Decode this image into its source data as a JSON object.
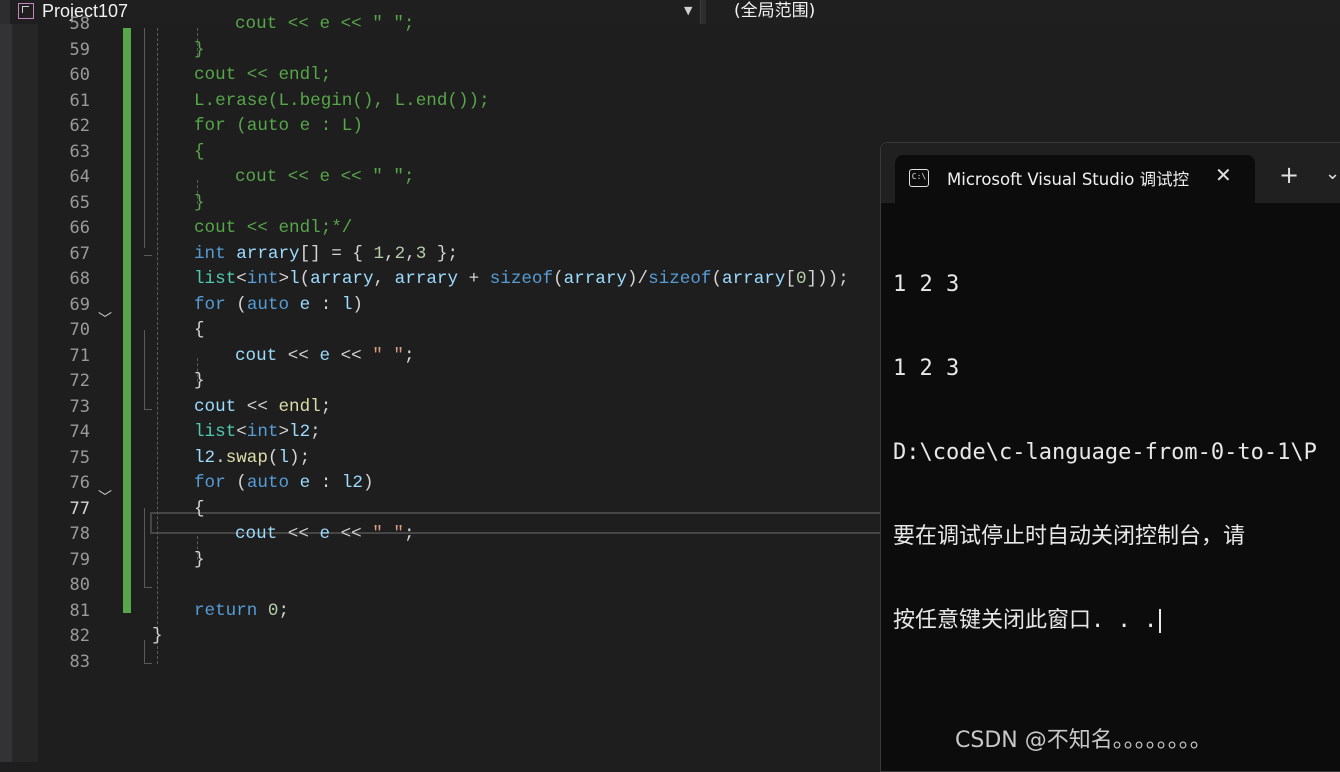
{
  "toolbar": {
    "project_name": "Project107",
    "scope": "(全局范围)"
  },
  "editor": {
    "current_line": "77",
    "lines": [
      {
        "n": "58",
        "t": [
          [
            "cm",
            "cout << e << \" \";"
          ]
        ]
      },
      {
        "n": "59",
        "t": [
          [
            "cm",
            "}"
          ]
        ]
      },
      {
        "n": "60",
        "t": [
          [
            "cm",
            "cout << endl;"
          ]
        ]
      },
      {
        "n": "61",
        "t": [
          [
            "cm",
            "L.erase(L.begin(), L.end());"
          ]
        ]
      },
      {
        "n": "62",
        "t": [
          [
            "cm",
            "for (auto e : L)"
          ]
        ]
      },
      {
        "n": "63",
        "t": [
          [
            "cm",
            "{"
          ]
        ]
      },
      {
        "n": "64",
        "t": [
          [
            "cm",
            "cout << e << \" \";"
          ]
        ]
      },
      {
        "n": "65",
        "t": [
          [
            "cm",
            "}"
          ]
        ]
      },
      {
        "n": "66",
        "t": [
          [
            "cm",
            "cout << endl;*/"
          ]
        ]
      },
      {
        "n": "67",
        "t": [
          [
            "kw",
            "int"
          ],
          [
            "tx",
            " "
          ],
          [
            "id",
            "arrary"
          ],
          [
            "tx",
            "[] = { "
          ],
          [
            "nm",
            "1"
          ],
          [
            "tx",
            ","
          ],
          [
            "nm",
            "2"
          ],
          [
            "tx",
            ","
          ],
          [
            "nm",
            "3"
          ],
          [
            "tx",
            " };"
          ]
        ]
      },
      {
        "n": "68",
        "t": [
          [
            "ty",
            "list"
          ],
          [
            "tx",
            "<"
          ],
          [
            "kw",
            "int"
          ],
          [
            "tx",
            ">"
          ],
          [
            "id",
            "l"
          ],
          [
            "tx",
            "("
          ],
          [
            "id",
            "arrary"
          ],
          [
            "tx",
            ", "
          ],
          [
            "id",
            "arrary"
          ],
          [
            "tx",
            " + "
          ],
          [
            "kw",
            "sizeof"
          ],
          [
            "tx",
            "("
          ],
          [
            "id",
            "arrary"
          ],
          [
            "tx",
            ")/"
          ],
          [
            "kw",
            "sizeof"
          ],
          [
            "tx",
            "("
          ],
          [
            "id",
            "arrary"
          ],
          [
            "tx",
            "["
          ],
          [
            "nm",
            "0"
          ],
          [
            "tx",
            "]));"
          ]
        ]
      },
      {
        "n": "69",
        "t": [
          [
            "kw",
            "for"
          ],
          [
            "tx",
            " ("
          ],
          [
            "kw",
            "auto"
          ],
          [
            "tx",
            " "
          ],
          [
            "id",
            "e"
          ],
          [
            "tx",
            " : "
          ],
          [
            "id",
            "l"
          ],
          [
            "tx",
            ")"
          ]
        ]
      },
      {
        "n": "70",
        "t": [
          [
            "tx",
            "{"
          ]
        ]
      },
      {
        "n": "71",
        "t": [
          [
            "id",
            "cout"
          ],
          [
            "tx",
            " << "
          ],
          [
            "id",
            "e"
          ],
          [
            "tx",
            " << "
          ],
          [
            "st",
            "\" \""
          ],
          [
            "tx",
            ";"
          ]
        ]
      },
      {
        "n": "72",
        "t": [
          [
            "tx",
            "}"
          ]
        ]
      },
      {
        "n": "73",
        "t": [
          [
            "id",
            "cout"
          ],
          [
            "tx",
            " << "
          ],
          [
            "fn",
            "endl"
          ],
          [
            "tx",
            ";"
          ]
        ]
      },
      {
        "n": "74",
        "t": [
          [
            "ty",
            "list"
          ],
          [
            "tx",
            "<"
          ],
          [
            "kw",
            "int"
          ],
          [
            "tx",
            ">"
          ],
          [
            "id",
            "l2"
          ],
          [
            "tx",
            ";"
          ]
        ]
      },
      {
        "n": "75",
        "t": [
          [
            "id",
            "l2"
          ],
          [
            "tx",
            "."
          ],
          [
            "fn",
            "swap"
          ],
          [
            "tx",
            "("
          ],
          [
            "id",
            "l"
          ],
          [
            "tx",
            ");"
          ]
        ]
      },
      {
        "n": "76",
        "t": [
          [
            "kw",
            "for"
          ],
          [
            "tx",
            " ("
          ],
          [
            "kw",
            "auto"
          ],
          [
            "tx",
            " "
          ],
          [
            "id",
            "e"
          ],
          [
            "tx",
            " : "
          ],
          [
            "id",
            "l2"
          ],
          [
            "tx",
            ")"
          ]
        ]
      },
      {
        "n": "77",
        "t": [
          [
            "tx",
            "{"
          ]
        ]
      },
      {
        "n": "78",
        "t": [
          [
            "id",
            "cout"
          ],
          [
            "tx",
            " << "
          ],
          [
            "id",
            "e"
          ],
          [
            "tx",
            " << "
          ],
          [
            "st",
            "\" \""
          ],
          [
            "tx",
            ";"
          ]
        ]
      },
      {
        "n": "79",
        "t": [
          [
            "tx",
            "}"
          ]
        ]
      },
      {
        "n": "80",
        "t": []
      },
      {
        "n": "81",
        "t": [
          [
            "kw",
            "return"
          ],
          [
            "tx",
            " "
          ],
          [
            "nm",
            "0"
          ],
          [
            "tx",
            ";"
          ]
        ]
      },
      {
        "n": "82",
        "t": [
          [
            "tx",
            "}"
          ]
        ]
      },
      {
        "n": "83",
        "t": []
      }
    ]
  },
  "console": {
    "tab_title": "Microsoft Visual Studio 调试控",
    "icon": "terminal-icon",
    "close_glyph": "✕",
    "new_tab_glyph": "+",
    "dropdown_glyph": "⌄",
    "output": [
      "1 2 3",
      "1 2 3",
      "D:\\code\\c-language-from-0-to-1\\P",
      "要在调试停止时自动关闭控制台，请",
      "按任意键关闭此窗口. . ."
    ]
  },
  "watermark": "CSDN @不知名。。。。。。。。"
}
